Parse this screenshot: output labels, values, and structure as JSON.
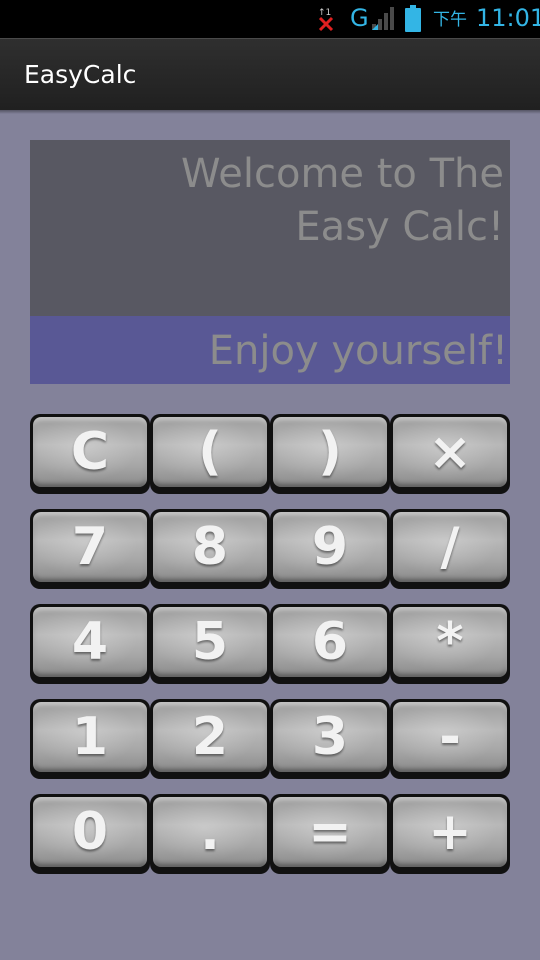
{
  "status_bar": {
    "network_type": "G",
    "ampm": "下午",
    "time": "11:01",
    "accent_color": "#33b5e5",
    "icons": [
      "signal-error-icon",
      "signal-bars-icon",
      "battery-icon"
    ]
  },
  "app": {
    "title": "EasyCalc"
  },
  "display": {
    "welcome_line1": "Welcome to The",
    "welcome_line2": "Easy Calc!",
    "message": "Enjoy yourself!"
  },
  "keypad": {
    "rows": [
      [
        "C",
        "(",
        ")",
        "×"
      ],
      [
        "7",
        "8",
        "9",
        "/"
      ],
      [
        "4",
        "5",
        "6",
        "*"
      ],
      [
        "1",
        "2",
        "3",
        "-"
      ],
      [
        "0",
        ".",
        "=",
        "+"
      ]
    ]
  },
  "colors": {
    "background": "#83829a",
    "display_top": "#585862",
    "display_bottom": "#595895",
    "display_text": "#8c8c8c"
  }
}
